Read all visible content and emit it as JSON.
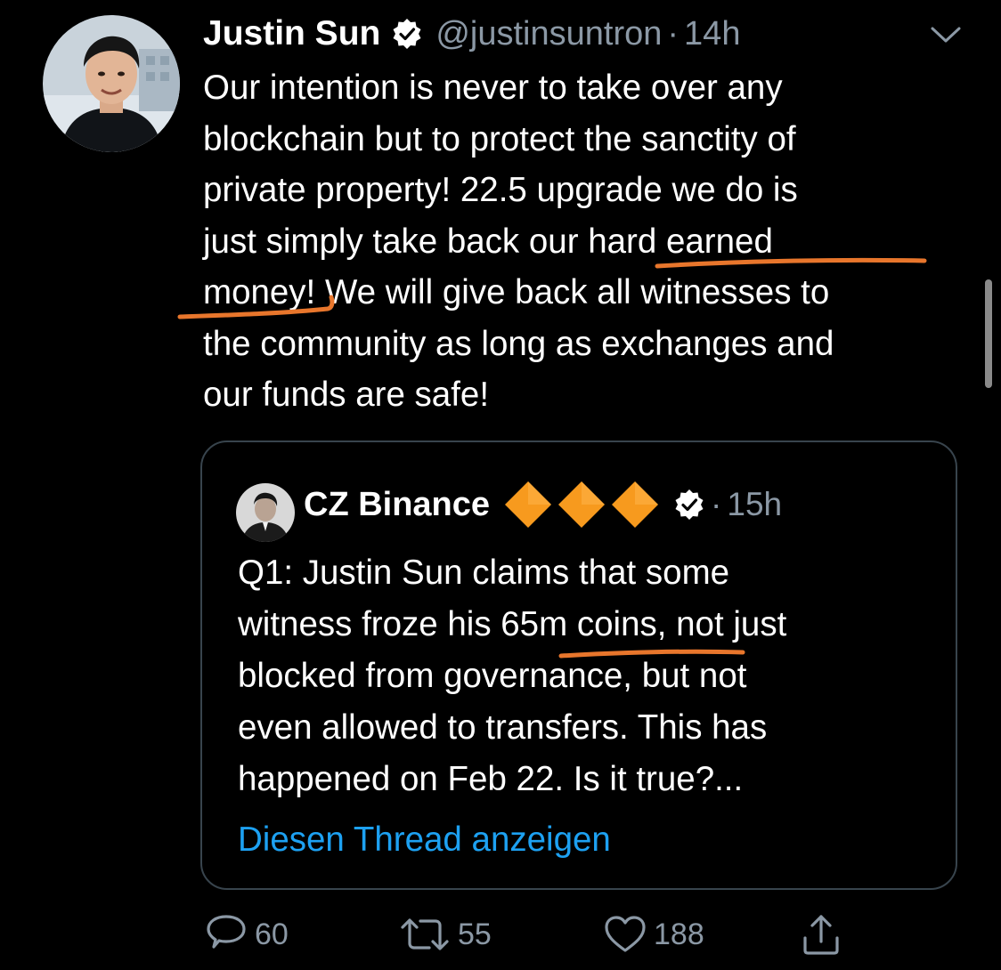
{
  "tweet": {
    "author_name": "Justin Sun",
    "handle": "@justinsuntron",
    "separator": "·",
    "time": "14h",
    "text_lines": [
      "Our intention is never to take over any",
      "blockchain but to protect the sanctity of",
      "private property! 22.5 upgrade we do is",
      "just simply take back our hard earned",
      "money! We will give back all witnesses to",
      "the community as long as exchanges and",
      "our funds are safe!"
    ],
    "icons": {
      "verified": "verified-badge-icon",
      "menu": "chevron-down-icon"
    }
  },
  "quote": {
    "author_name": "CZ Binance",
    "separator": "·",
    "time": "15h",
    "text_lines": [
      "Q1: Justin Sun claims that some",
      "witness froze his 65m coins, not just",
      "blocked from governance, but not",
      "even allowed to transfers. This has",
      "happened on Feb 22. Is it true?..."
    ],
    "show_thread": "Diesen Thread anzeigen",
    "emoji": [
      "orange-diamond",
      "orange-diamond",
      "orange-diamond"
    ]
  },
  "actions": {
    "reply_count": "60",
    "retweet_count": "55",
    "like_count": "188"
  },
  "colors": {
    "background": "#000000",
    "text": "#ffffff",
    "secondary": "#8b98a5",
    "link": "#1da1f2",
    "border": "#38444d",
    "annotation": "#e8762c",
    "diamond": "#f79a1e"
  }
}
